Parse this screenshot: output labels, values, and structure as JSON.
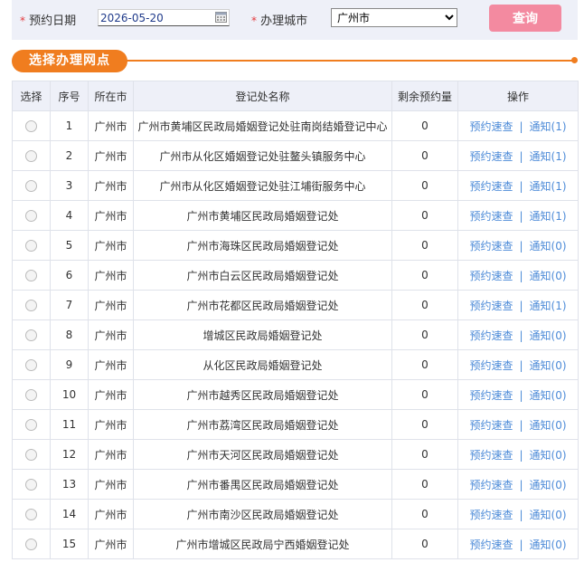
{
  "filter": {
    "required_mark": "*",
    "date_label": "预约日期",
    "date_value": "2026-05-20",
    "city_label": "办理城市",
    "city_selected": "广州市",
    "query_button": "查询"
  },
  "section": {
    "title": "选择办理网点"
  },
  "table": {
    "headers": [
      "选择",
      "序号",
      "所在市",
      "登记处名称",
      "剩余预约量",
      "操作"
    ],
    "action_quick": "预约速查",
    "action_separator": "|",
    "rows": [
      {
        "no": "1",
        "city": "广州市",
        "name": "广州市黄埔区民政局婚姻登记处驻南岗结婚登记中心",
        "remaining": "0",
        "notice": "通知(1)"
      },
      {
        "no": "2",
        "city": "广州市",
        "name": "广州市从化区婚姻登记处驻鳌头镇服务中心",
        "remaining": "0",
        "notice": "通知(1)"
      },
      {
        "no": "3",
        "city": "广州市",
        "name": "广州市从化区婚姻登记处驻江埔街服务中心",
        "remaining": "0",
        "notice": "通知(1)"
      },
      {
        "no": "4",
        "city": "广州市",
        "name": "广州市黄埔区民政局婚姻登记处",
        "remaining": "0",
        "notice": "通知(1)"
      },
      {
        "no": "5",
        "city": "广州市",
        "name": "广州市海珠区民政局婚姻登记处",
        "remaining": "0",
        "notice": "通知(0)"
      },
      {
        "no": "6",
        "city": "广州市",
        "name": "广州市白云区民政局婚姻登记处",
        "remaining": "0",
        "notice": "通知(0)"
      },
      {
        "no": "7",
        "city": "广州市",
        "name": "广州市花都区民政局婚姻登记处",
        "remaining": "0",
        "notice": "通知(1)"
      },
      {
        "no": "8",
        "city": "广州市",
        "name": "增城区民政局婚姻登记处",
        "remaining": "0",
        "notice": "通知(0)"
      },
      {
        "no": "9",
        "city": "广州市",
        "name": "从化区民政局婚姻登记处",
        "remaining": "0",
        "notice": "通知(0)"
      },
      {
        "no": "10",
        "city": "广州市",
        "name": "广州市越秀区民政局婚姻登记处",
        "remaining": "0",
        "notice": "通知(0)"
      },
      {
        "no": "11",
        "city": "广州市",
        "name": "广州市荔湾区民政局婚姻登记处",
        "remaining": "0",
        "notice": "通知(0)"
      },
      {
        "no": "12",
        "city": "广州市",
        "name": "广州市天河区民政局婚姻登记处",
        "remaining": "0",
        "notice": "通知(0)"
      },
      {
        "no": "13",
        "city": "广州市",
        "name": "广州市番禺区民政局婚姻登记处",
        "remaining": "0",
        "notice": "通知(0)"
      },
      {
        "no": "14",
        "city": "广州市",
        "name": "广州市南沙区民政局婚姻登记处",
        "remaining": "0",
        "notice": "通知(0)"
      },
      {
        "no": "15",
        "city": "广州市",
        "name": "广州市增城区民政局宁西婚姻登记处",
        "remaining": "0",
        "notice": "通知(0)"
      }
    ]
  },
  "colors": {
    "accent_orange": "#f07d1f",
    "query_button": "#f38aa0",
    "link_blue": "#4d8bd8",
    "remaining_red": "#cc0000",
    "header_bg": "#eef0f8"
  },
  "icons": {
    "date_picker": "calendar-icon"
  }
}
